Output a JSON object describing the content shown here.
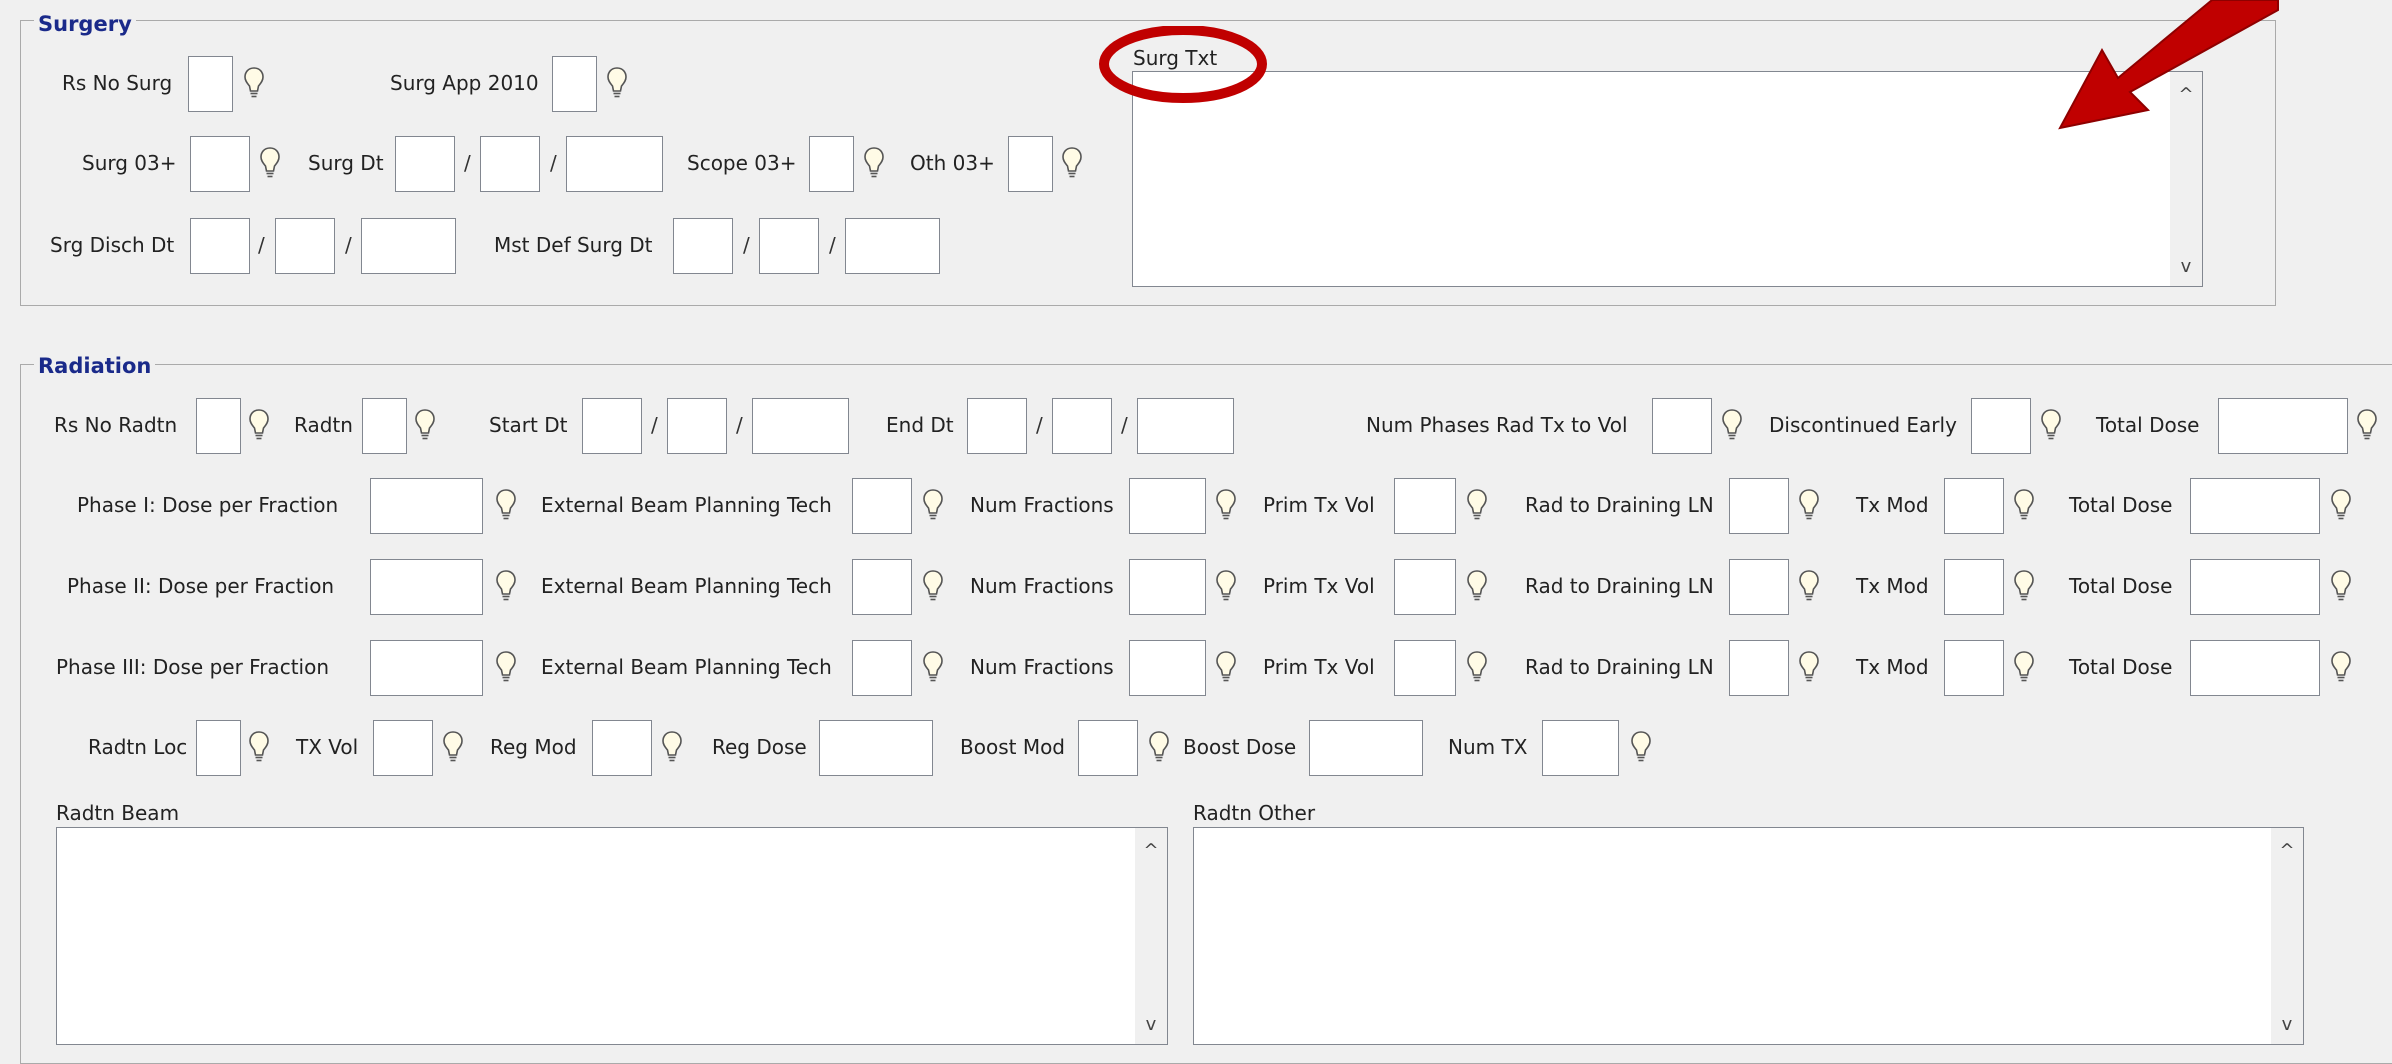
{
  "surgery": {
    "title": "Surgery",
    "rs_no_surg": "Rs No Surg",
    "surg_app_2010": "Surg App 2010",
    "surg_03": "Surg 03+",
    "surg_dt": "Surg Dt",
    "scope_03": "Scope 03+",
    "oth_03": "Oth 03+",
    "srg_disch_dt": "Srg Disch Dt",
    "mst_def_surg_dt": "Mst Def Surg Dt",
    "surg_txt": "Surg Txt",
    "date_sep": "/"
  },
  "radiation": {
    "title": "Radiation",
    "rs_no_radtn": "Rs No Radtn",
    "radtn": "Radtn",
    "start_dt": "Start Dt",
    "end_dt": "End Dt",
    "num_phases": "Num Phases Rad Tx to Vol",
    "discontinued_early": "Discontinued Early",
    "total_dose": "Total Dose",
    "phases": [
      {
        "label": "Phase I:  Dose per Fraction"
      },
      {
        "label": "Phase II:  Dose per Fraction"
      },
      {
        "label": "Phase III:  Dose per Fraction"
      }
    ],
    "ext_beam": "External Beam Planning Tech",
    "num_fractions": "Num Fractions",
    "prim_tx_vol": "Prim Tx Vol",
    "rad_draining": "Rad to Draining LN",
    "tx_mod": "Tx Mod",
    "radtn_loc": "Radtn Loc",
    "tx_vol": "TX Vol",
    "reg_mod": "Reg Mod",
    "reg_dose": "Reg Dose",
    "boost_mod": "Boost Mod",
    "boost_dose": "Boost Dose",
    "num_tx": "Num TX",
    "radtn_beam": "Radtn Beam",
    "radtn_other": "Radtn Other"
  },
  "annotation": {
    "color": "#c00000",
    "circle_target": "Surg Txt",
    "arrow_target": "Surg Txt textbox"
  },
  "icons": {
    "help": "lightbulb-icon",
    "scroll_up": "^",
    "scroll_down": "v"
  }
}
